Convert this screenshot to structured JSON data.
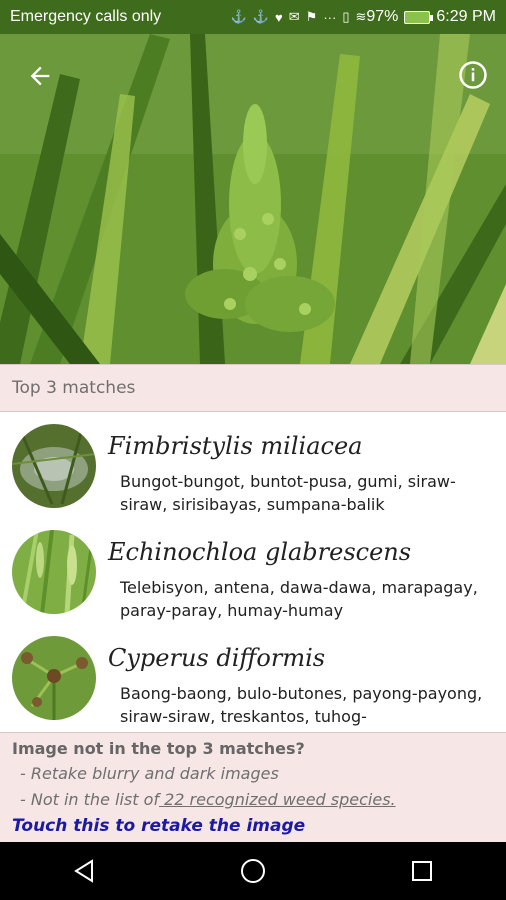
{
  "status_bar": {
    "left_text": "Emergency calls only",
    "battery": "97%",
    "time": "6:29 PM"
  },
  "header": {
    "title": "Top 3 matches"
  },
  "matches": [
    {
      "scientific_name": "Fimbristylis miliacea",
      "common_names": "Bungot-bungot, buntot-pusa, gumi, siraw-siraw, sirisibayas, sumpana-balik"
    },
    {
      "scientific_name": "Echinochloa glabrescens",
      "common_names": "Telebisyon, antena, dawa-dawa, marapagay, paray-paray, humay-humay"
    },
    {
      "scientific_name": "Cyperus difformis",
      "common_names": "Baong-baong, bulo-butones, payong-payong, siraw-siraw, treskantos, tuhog-"
    }
  ],
  "footer": {
    "question": "Image not in the top 3 matches?",
    "tip1": "- Retake blurry and dark images",
    "tip2_prefix": "- Not in the list of",
    "tip2_link": " 22 recognized weed species.",
    "retake": "Touch this to retake the image"
  },
  "colors": {
    "status_bar": "#3f6b1c",
    "header_bg": "#f7e6e6",
    "retake_link": "#1a1aa6"
  },
  "icons": [
    "back-arrow-icon",
    "info-icon",
    "nav-back-icon",
    "nav-home-icon",
    "nav-recents-icon"
  ]
}
